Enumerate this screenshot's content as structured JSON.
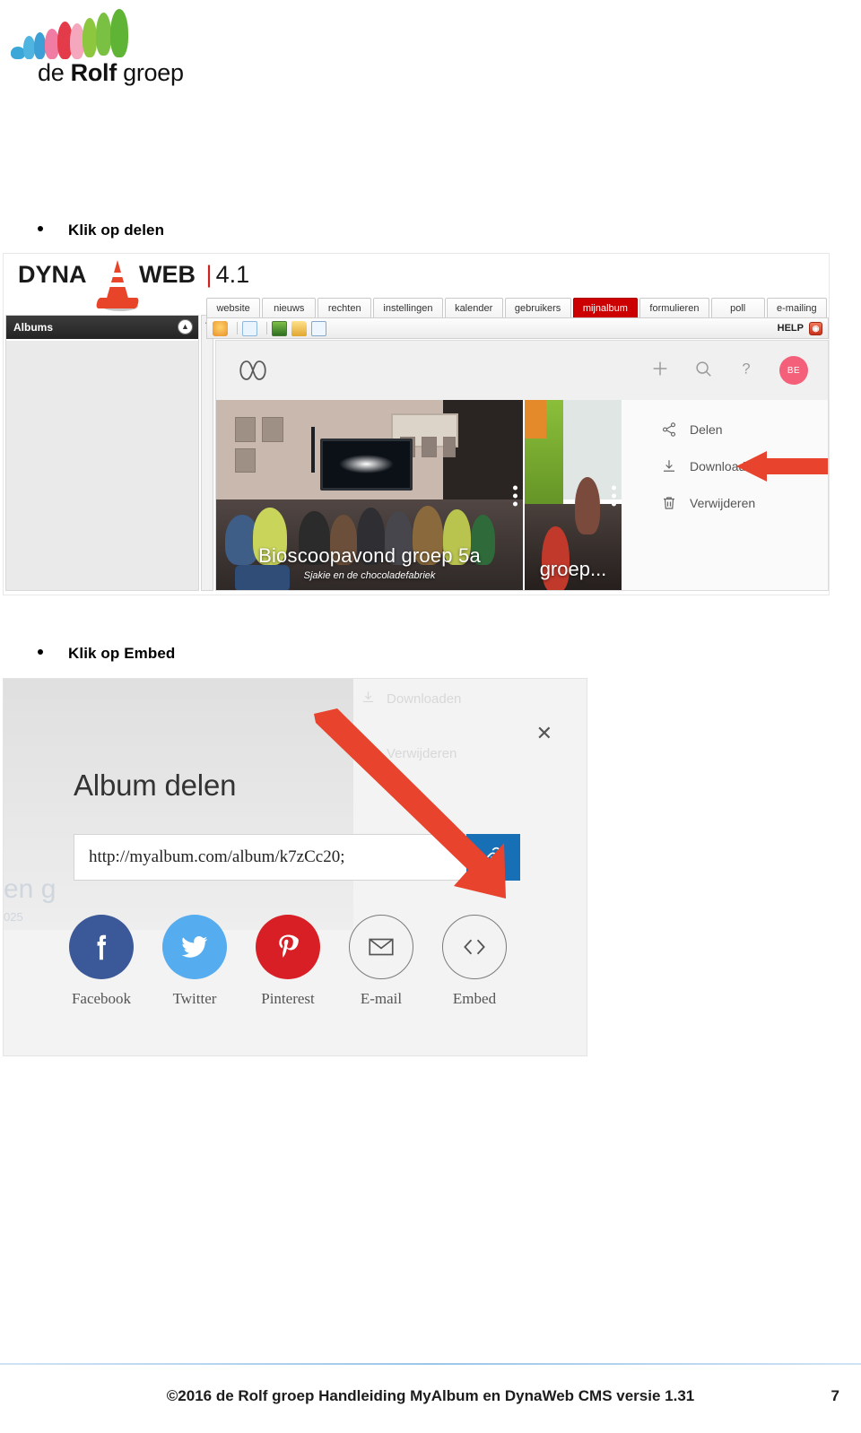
{
  "brand": {
    "logo_text_part1": "de ",
    "logo_text_bold": "Rolf",
    "logo_text_part2": " groep"
  },
  "steps": [
    {
      "label": "Klik op delen"
    },
    {
      "label": "Klik op Embed"
    }
  ],
  "screenshot1": {
    "app_logo": "DYNA",
    "app_logo2": "WEB",
    "app_sep": "|",
    "app_version": "4.1",
    "cone_icon": "traffic-cone-icon",
    "sidebar": {
      "title": "Albums",
      "collapse_icon": "chevron-double-up-icon"
    },
    "tabs": [
      {
        "label": "website",
        "active": false
      },
      {
        "label": "nieuws",
        "active": false
      },
      {
        "label": "rechten",
        "active": false
      },
      {
        "label": "instellingen",
        "active": false
      },
      {
        "label": "kalender",
        "active": false
      },
      {
        "label": "gebruikers",
        "active": false
      },
      {
        "label": "mijnalbum",
        "active": true
      },
      {
        "label": "formulieren",
        "active": false
      },
      {
        "label": "poll",
        "active": false
      },
      {
        "label": "e-mailing",
        "active": false
      }
    ],
    "toolbar": {
      "icons": [
        "home-icon",
        "new-page-icon",
        "image-icon",
        "folder-icon",
        "preview-icon"
      ],
      "help_label": "HELP",
      "help_icon": "help-button-icon"
    },
    "myalbum": {
      "logo_icon": "myalbum-infinity-logo",
      "add_icon": "plus-icon",
      "search_icon": "search-icon",
      "help_icon": "question-mark-icon",
      "avatar_initials": "BE",
      "avatar_color": "#f4607a",
      "photos": [
        {
          "title": "Bioscoopavond groep 5a",
          "subtitle": "Sjakie en de chocoladefabriek"
        },
        {
          "title": "groep..."
        }
      ],
      "menu": [
        {
          "label": "Delen",
          "icon": "share-icon"
        },
        {
          "label": "Downloaden",
          "icon": "download-icon"
        },
        {
          "label": "Verwijderen",
          "icon": "trash-icon"
        }
      ]
    },
    "arrow_color": "#e8432c"
  },
  "screenshot2": {
    "dialog_title": "Album delen",
    "close_icon": "close-icon",
    "share_url": "http://myalbum.com/album/k7zCc20;",
    "copy_icon": "link-icon",
    "copy_button_color": "#176fb5",
    "socials": [
      {
        "label": "Facebook",
        "icon": "facebook-icon",
        "color": "#3b5998",
        "filled": true
      },
      {
        "label": "Twitter",
        "icon": "twitter-icon",
        "color": "#55acee",
        "filled": true
      },
      {
        "label": "Pinterest",
        "icon": "pinterest-icon",
        "color": "#d81f26",
        "filled": true
      },
      {
        "label": "E-mail",
        "icon": "envelope-icon",
        "color": "#7b7b7b",
        "filled": false
      },
      {
        "label": "Embed",
        "icon": "code-brackets-icon",
        "color": "#7b7b7b",
        "filled": false
      }
    ],
    "background_menu": [
      {
        "label": "Downloaden",
        "icon": "download-icon"
      },
      {
        "label": "Verwijderen",
        "icon": "trash-icon"
      }
    ],
    "background_text": "en g",
    "background_text2": "025",
    "arrow_color": "#e8432c"
  },
  "footer": {
    "text": "©2016 de Rolf groep   Handleiding MyAlbum en DynaWeb CMS versie 1.31",
    "page_number": "7"
  }
}
